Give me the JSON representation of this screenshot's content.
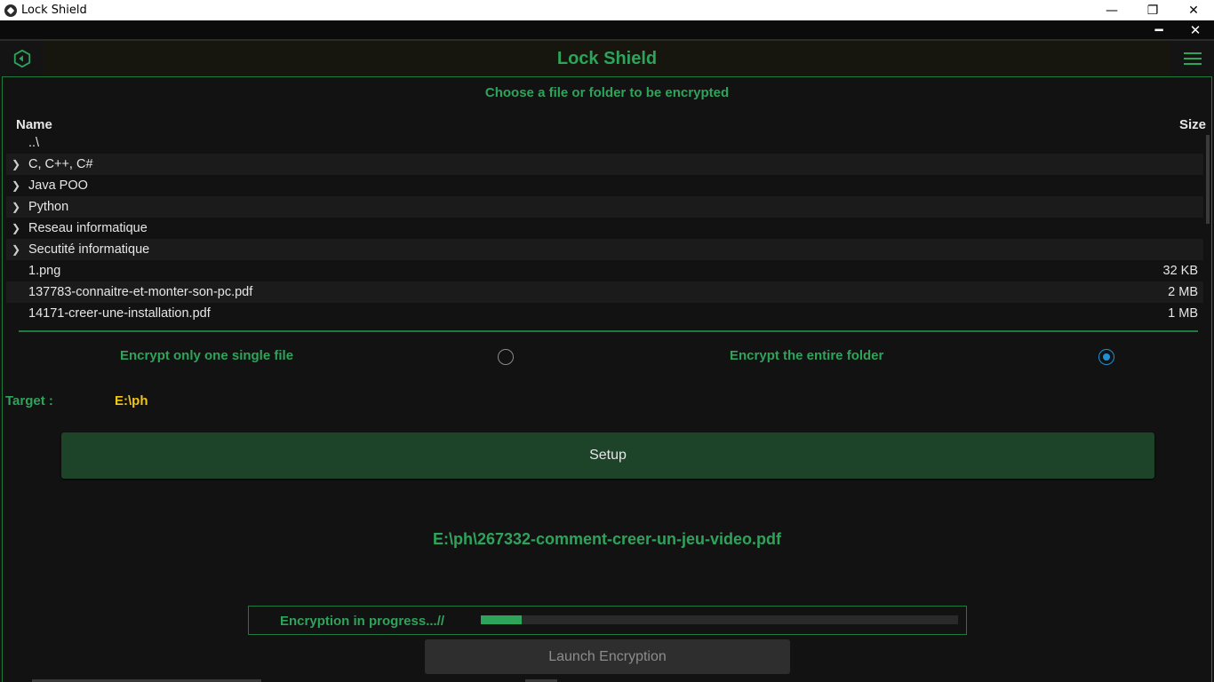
{
  "window": {
    "title": "Lock Shield",
    "minimize": "—",
    "restore": "❐",
    "close": "✕"
  },
  "inner_bar": {
    "minimize": "━",
    "close": "✕"
  },
  "header": {
    "title": "Lock Shield",
    "back_icon": "hex-back-icon",
    "menu_icon": "hamburger-icon",
    "accent": "#2ea35a"
  },
  "browser": {
    "title": "Choose a file or folder to be encrypted",
    "col_name": "Name",
    "col_size": "Size",
    "rows": [
      {
        "name": "..\\",
        "size": "",
        "folder": false
      },
      {
        "name": "C, C++, C#",
        "size": "",
        "folder": true
      },
      {
        "name": "Java POO",
        "size": "",
        "folder": true
      },
      {
        "name": "Python",
        "size": "",
        "folder": true
      },
      {
        "name": "Reseau informatique",
        "size": "",
        "folder": true
      },
      {
        "name": "Secutité informatique",
        "size": "",
        "folder": true
      },
      {
        "name": "1.png",
        "size": "32 KB",
        "folder": false
      },
      {
        "name": "137783-connaitre-et-monter-son-pc.pdf",
        "size": "2 MB",
        "folder": false
      },
      {
        "name": "14171-creer-une-installation.pdf",
        "size": "1 MB",
        "folder": false
      }
    ]
  },
  "options": {
    "single_file_label": "Encrypt only one single file",
    "single_file_checked": false,
    "entire_folder_label": "Encrypt the entire folder",
    "entire_folder_checked": true
  },
  "target": {
    "label": "Target :",
    "value": "E:\\ph"
  },
  "setup_button": "Setup",
  "current_file": "E:\\ph\\267332-comment-creer-un-jeu-video.pdf",
  "progress": {
    "text": "Encryption in progress...//",
    "fraction": 0.085
  },
  "launch_button": "Launch Encryption"
}
